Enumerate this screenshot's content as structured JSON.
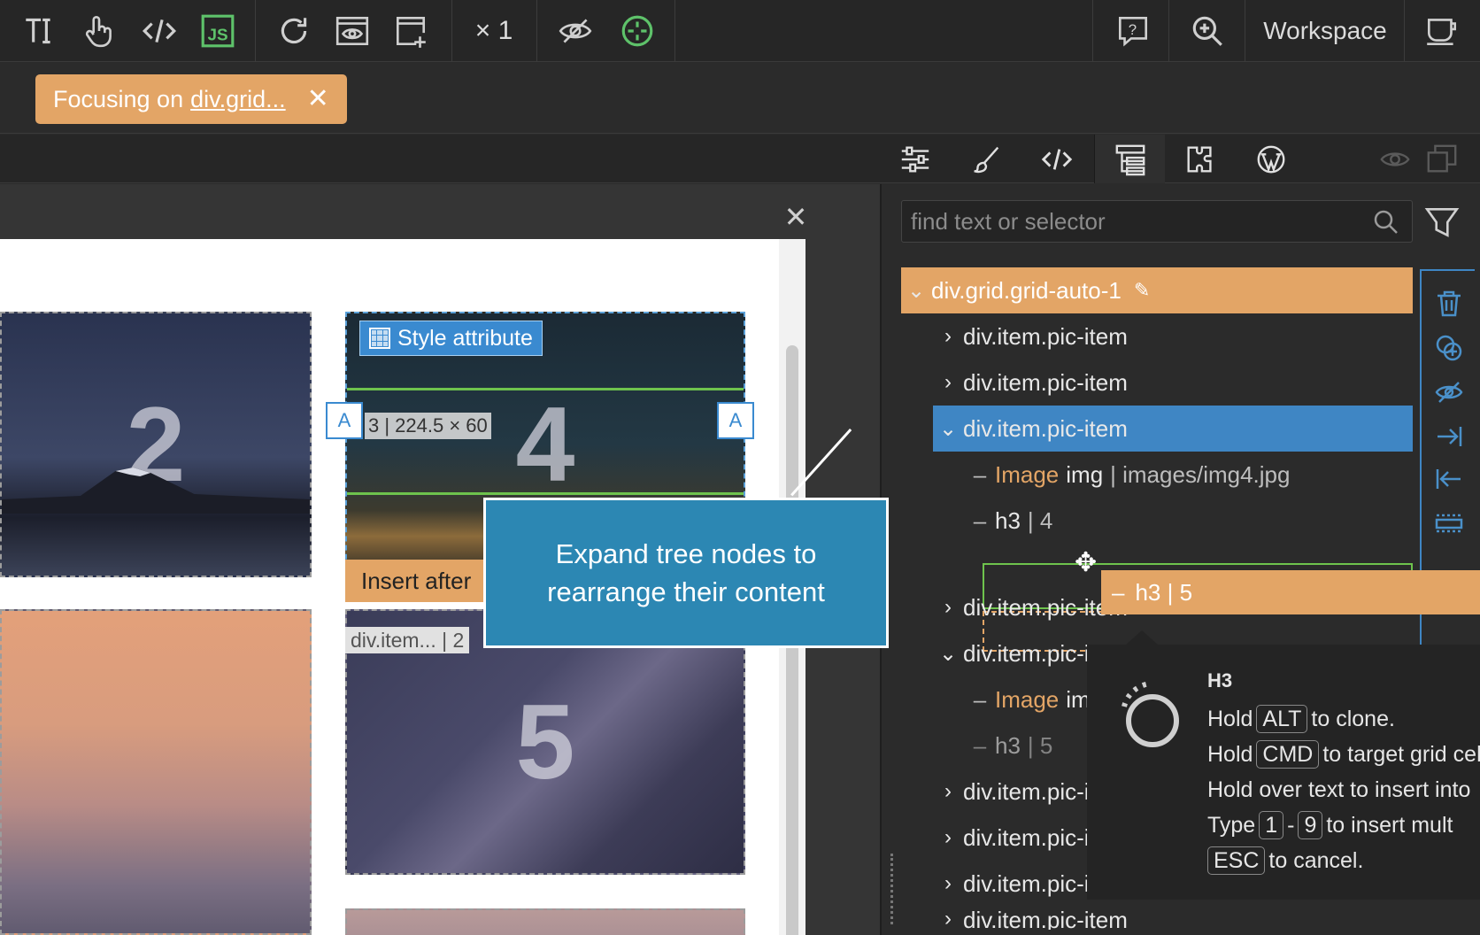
{
  "toolbar": {
    "icons": [
      "text-icon",
      "hand-pointer-icon",
      "code-icon",
      "js-icon",
      "refresh-icon",
      "preview-icon",
      "add-page-icon",
      "eye-off-icon",
      "target-icon",
      "help-icon",
      "zoom-icon",
      "cup-icon"
    ],
    "zoom_label": "× 1",
    "workspace_label": "Workspace"
  },
  "focus": {
    "prefix": "Focusing on",
    "target": "div.grid...",
    "close": "✕"
  },
  "panel_tabs": [
    "settings-sliders-icon",
    "brush-icon",
    "code-icon",
    "tree-icon",
    "components-icon",
    "wordpress-icon",
    "eye-icon",
    "copy-icon"
  ],
  "canvas": {
    "close": "✕",
    "pic_numbers": [
      "2",
      "4",
      "5"
    ],
    "style_attribute": "Style attribute",
    "dimension_label": "3 | 224.5 × 60",
    "a_label": "A",
    "insert_after": "Insert after",
    "item_label": "div.item... | 2",
    "callout": "Expand tree nodes to rearrange their content"
  },
  "search": {
    "placeholder": "find text or selector"
  },
  "tree": {
    "root": "div.grid.grid-auto-1",
    "items": [
      {
        "label": "div.item.pic-item"
      },
      {
        "label": "div.item.pic-item"
      },
      {
        "label": "div.item.pic-item"
      },
      {
        "label": "div.item.pic-item"
      },
      {
        "label": "div.item.pic-item"
      },
      {
        "label": "div.item.pic-item"
      },
      {
        "label": "div.item.pic-item"
      },
      {
        "label": "div.item.pic-item"
      },
      {
        "label": "div.item.pic-item"
      }
    ],
    "image_tag": "Image",
    "image_el": "img",
    "image_src": "| images/img4.jpg",
    "h3_4": "h3",
    "h3_4_val": "| 4",
    "h3_5": "h3",
    "h3_5_val": "| 5",
    "drag_pill": "h3 | 5"
  },
  "tooltip": {
    "title": "H3",
    "l1_pre": "Hold",
    "l1_key": "ALT",
    "l1_post": "to clone.",
    "l2_pre": "Hold",
    "l2_key": "CMD",
    "l2_post": "to target grid cel",
    "l3": "Hold over text to insert into",
    "l4_pre": "Type",
    "l4_k1": "1",
    "l4_mid": "-",
    "l4_k2": "9",
    "l4_post": "to insert mult",
    "l5_key": "ESC",
    "l5_post": "to cancel."
  },
  "colors": {
    "accent_orange": "#e3a566",
    "selection_blue": "#3f86c4",
    "callout_blue": "#2c87b3",
    "js_green": "#5ec26a"
  }
}
